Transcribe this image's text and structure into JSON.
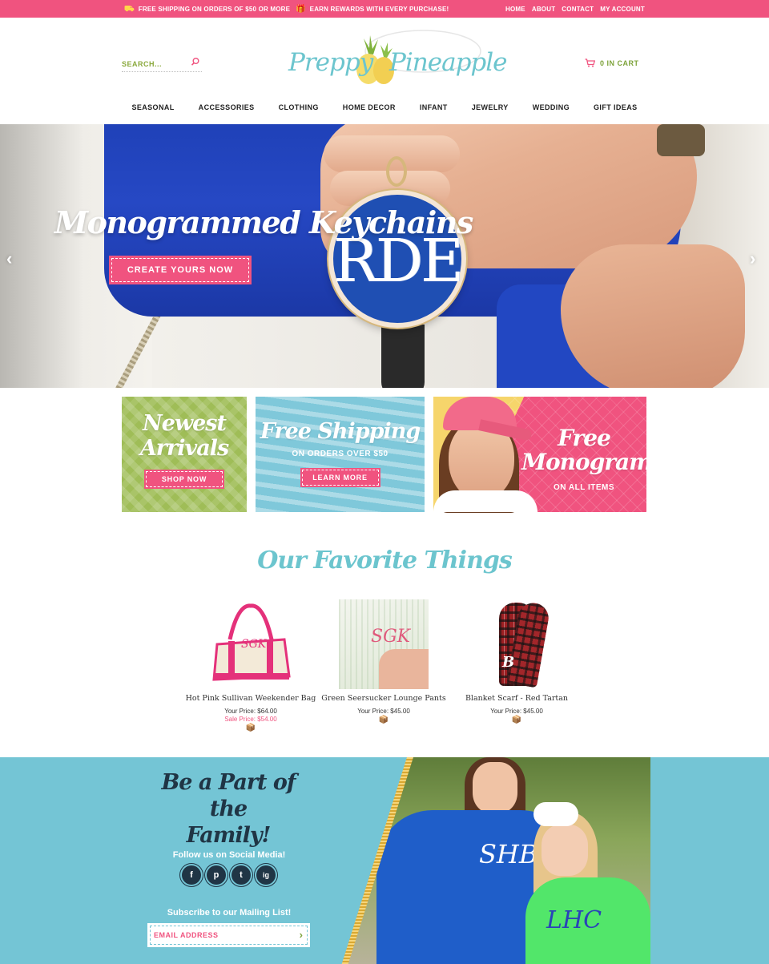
{
  "topbar": {
    "promo_shipping": "FREE SHIPPING ON ORDERS OF $50 OR MORE",
    "promo_rewards": "EARN REWARDS WITH EVERY PURCHASE!",
    "links": [
      "HOME",
      "ABOUT",
      "CONTACT",
      "MY ACCOUNT"
    ]
  },
  "header": {
    "search_placeholder": "SEARCH...",
    "logo_left": "Preppy",
    "logo_right": "Pineapple",
    "cart_label": "0 IN CART"
  },
  "nav": [
    "SEASONAL",
    "ACCESSORIES",
    "CLOTHING",
    "HOME DECOR",
    "INFANT",
    "JEWELRY",
    "WEDDING",
    "GIFT IDEAS"
  ],
  "hero": {
    "headline": "Monogrammed Keychains",
    "cta": "CREATE YOURS NOW",
    "monogram": "RDE",
    "prev": "‹",
    "next": "›"
  },
  "tiles": {
    "newest": {
      "line1": "Newest",
      "line2": "Arrivals",
      "button": "SHOP NOW"
    },
    "shipping": {
      "title": "Free Shipping",
      "sub": "ON ORDERS OVER $50",
      "button": "LEARN MORE"
    },
    "monograms": {
      "line1": "Free",
      "line2": "Monograms",
      "sub": "ON ALL ITEMS"
    }
  },
  "favorites": {
    "title": "Our Favorite Things",
    "products": [
      {
        "name": "Hot Pink Sullivan Weekender Bag",
        "price": "Your Price: $64.00",
        "sale": "Sale Price: $54.00",
        "monogram": "SGK"
      },
      {
        "name": "Green Seersucker Lounge Pants",
        "price": "Your Price: $45.00",
        "sale": "",
        "monogram": "SGK"
      },
      {
        "name": "Blanket Scarf - Red Tartan",
        "price": "Your Price: $45.00",
        "sale": "",
        "monogram": "B"
      }
    ]
  },
  "family": {
    "title_line1": "Be a Part of the",
    "title_line2": "Family!",
    "follow": "Follow us on Social Media!",
    "socials": [
      "f",
      "p",
      "t",
      "ig"
    ],
    "subscribe": "Subscribe to our Mailing List!",
    "email_placeholder": "EMAIL ADDRESS",
    "submit": "›",
    "shirt_monogram_1": "SHB",
    "shirt_monogram_2": "LHC"
  },
  "colors": {
    "pink": "#f0537f",
    "teal": "#6cc5ce",
    "green": "#7ea33b",
    "navy": "#203545",
    "aqua": "#74c5d5"
  }
}
